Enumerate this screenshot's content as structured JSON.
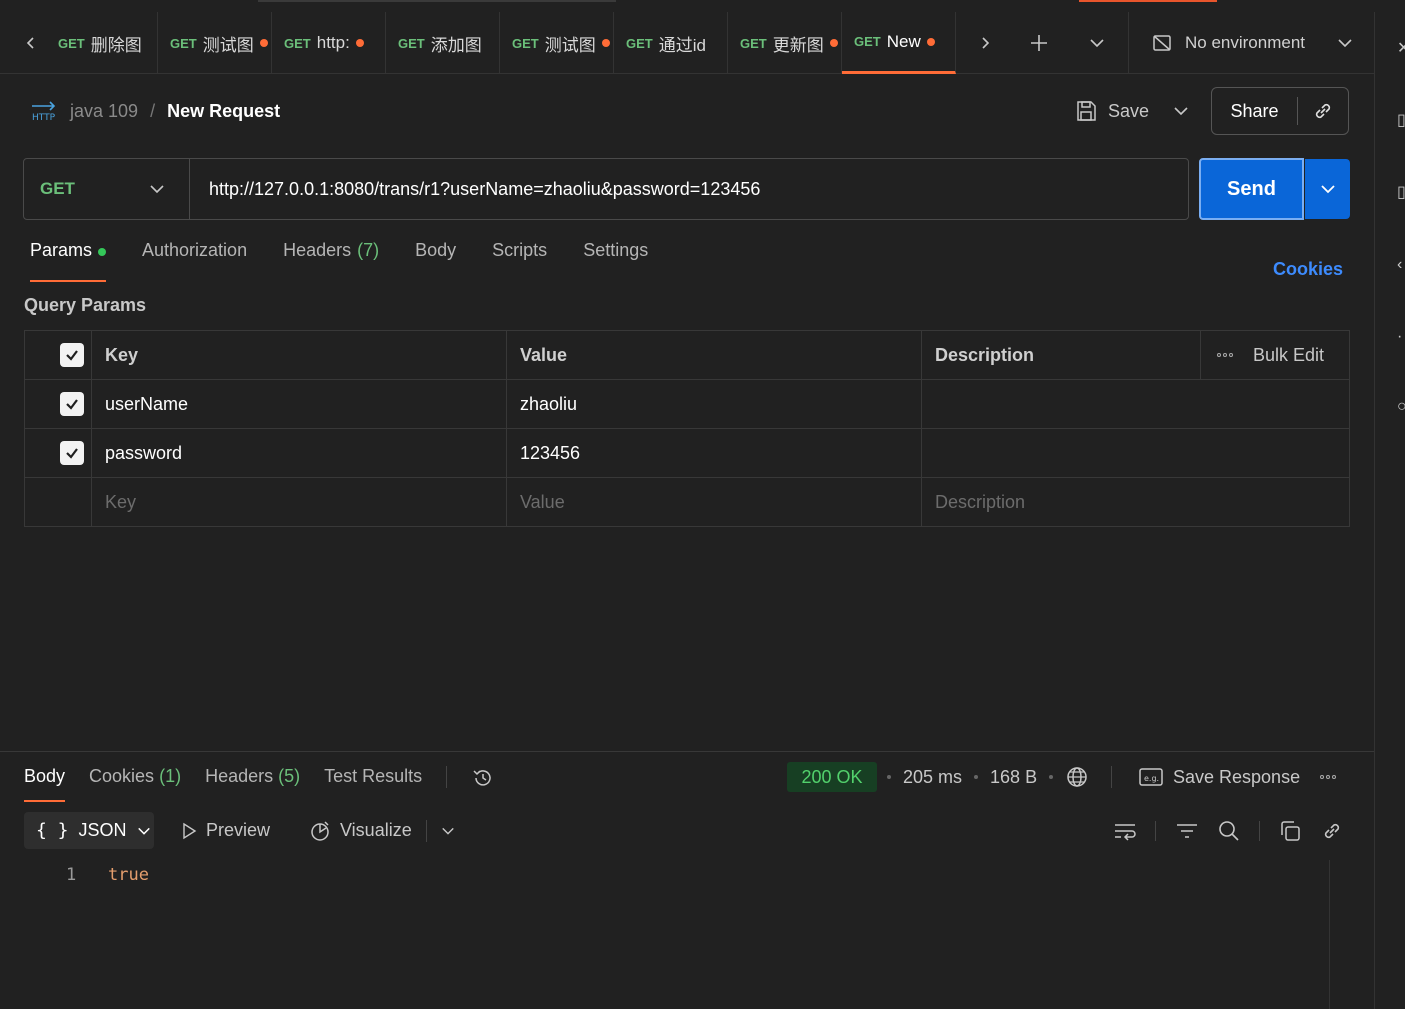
{
  "tabs": [
    {
      "method": "GET",
      "name": "删除图",
      "dirty": false
    },
    {
      "method": "GET",
      "name": "测试图",
      "dirty": true
    },
    {
      "method": "GET",
      "name": "http:",
      "dirty": true
    },
    {
      "method": "GET",
      "name": "添加图",
      "dirty": false
    },
    {
      "method": "GET",
      "name": "测试图",
      "dirty": true
    },
    {
      "method": "GET",
      "name": "通过id",
      "dirty": false
    },
    {
      "method": "GET",
      "name": "更新图",
      "dirty": true
    },
    {
      "method": "GET",
      "name": "New",
      "dirty": true,
      "active": true
    }
  ],
  "environment": "No environment",
  "breadcrumb": {
    "collection": "java 109",
    "separator": "/",
    "request": "New Request"
  },
  "header_actions": {
    "save": "Save",
    "share": "Share"
  },
  "request": {
    "method": "GET",
    "url": "http://127.0.0.1:8080/trans/r1?userName=zhaoliu&password=123456",
    "send": "Send"
  },
  "request_tabs": {
    "params": "Params",
    "authorization": "Authorization",
    "headers": "Headers",
    "headers_count": "(7)",
    "body": "Body",
    "scripts": "Scripts",
    "settings": "Settings"
  },
  "cookies_link": "Cookies",
  "query_params": {
    "title": "Query Params",
    "headers": {
      "key": "Key",
      "value": "Value",
      "description": "Description",
      "bulk_edit": "Bulk Edit"
    },
    "rows": [
      {
        "key": "userName",
        "value": "zhaoliu",
        "description": ""
      },
      {
        "key": "password",
        "value": "123456",
        "description": ""
      }
    ],
    "placeholders": {
      "key": "Key",
      "value": "Value",
      "description": "Description"
    }
  },
  "response_tabs": {
    "body": "Body",
    "cookies": "Cookies",
    "cookies_count": "(1)",
    "headers": "Headers",
    "headers_count": "(5)",
    "test_results": "Test Results"
  },
  "response_meta": {
    "status": "200 OK",
    "time": "205 ms",
    "size": "168 B",
    "save_response": "Save Response"
  },
  "response_view": {
    "format_brace": "{ }",
    "format": "JSON",
    "preview": "Preview",
    "visualize": "Visualize"
  },
  "response_body": {
    "line_number": "1",
    "content": "true"
  },
  "colors": {
    "accent": "#ff6c37",
    "send": "#0a66d8",
    "method_get": "#6bbf7a",
    "status_ok": "#52d16c",
    "link": "#3d8bfd"
  }
}
